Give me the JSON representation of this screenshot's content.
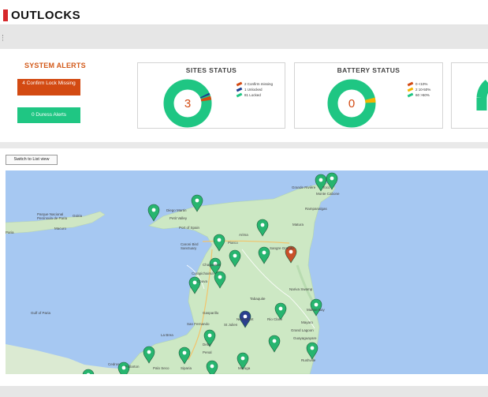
{
  "app": {
    "logo_text": "OUTLOCKS"
  },
  "system_alerts": {
    "title": "SYSTEM ALERTS",
    "confirm_lock_label": "4 Confirm Lock Missing",
    "duress_label": "0 Duress Alerts"
  },
  "sites_status": {
    "title": "SITES STATUS",
    "center_value": "3",
    "legend": [
      {
        "label": "2 Confirm missing",
        "color": "#d34a12"
      },
      {
        "label": "1 Unlocked",
        "color": "#1e3f8f"
      },
      {
        "label": "81 Locked",
        "color": "#1fc683"
      }
    ]
  },
  "battery_status": {
    "title": "BATTERY STATUS",
    "center_value": "0",
    "legend": [
      {
        "label": "0 <10%",
        "color": "#d34a12"
      },
      {
        "label": "2 10-50%",
        "color": "#f5b400"
      },
      {
        "label": "60 >50%",
        "color": "#1fc683"
      }
    ]
  },
  "map_view": {
    "switch_label": "Switch to List view",
    "places": [
      "Grande Rivière",
      "Toco",
      "Monte Cabone",
      "Rampanalgas",
      "Matura",
      "Diego Martin",
      "Petit Valley",
      "Port of Spain",
      "Arima",
      "Piarco",
      "Sangre Grande",
      "Caroni Bird Sanctuary",
      "Chaguanas",
      "Carapichaima",
      "Couva",
      "Nariva Swamp",
      "Tabaquite",
      "Gasparillo",
      "San Fernando",
      "St Julien",
      "New Grant",
      "Rio Claro",
      "Mayaro",
      "Guayaguayare",
      "Debe",
      "Penal",
      "La Brea",
      "Siparia",
      "Moruga",
      "Cedros",
      "Fullarton",
      "Palo Seco",
      "Gulf of Paria",
      "Paria",
      "Parque Nacional Península de Paria",
      "Macuro",
      "Güiria",
      "Rushville",
      "Mahoe Bay",
      "Grand Lagoon"
    ]
  }
}
